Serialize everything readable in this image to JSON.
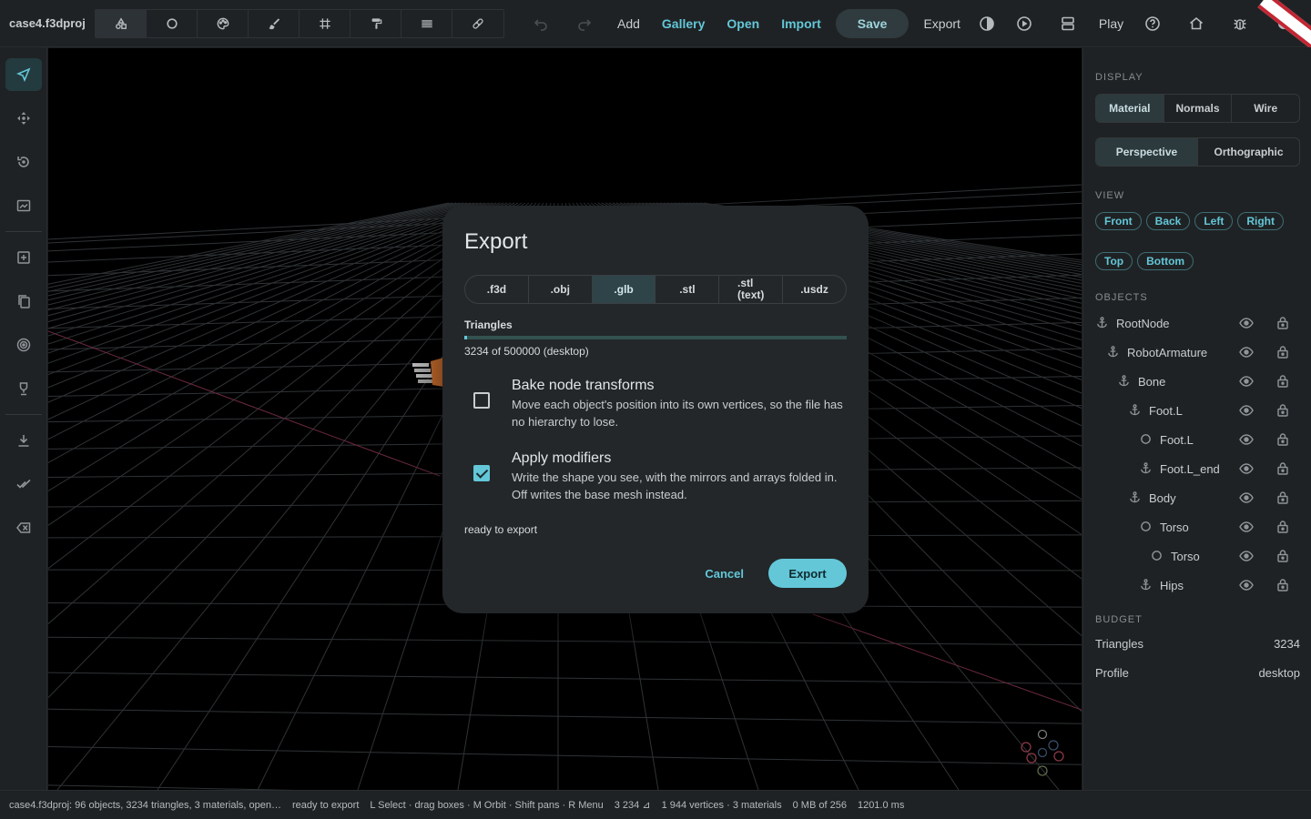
{
  "app": {
    "project_title": "case4.f3dproj"
  },
  "toolbar": {
    "tools": [
      {
        "name": "shapes",
        "icon": "shapes-icon"
      },
      {
        "name": "circle",
        "icon": "circle-icon"
      },
      {
        "name": "palette",
        "icon": "palette-icon"
      },
      {
        "name": "brush",
        "icon": "brush-icon"
      },
      {
        "name": "grid",
        "icon": "grid-icon"
      },
      {
        "name": "paint-roller",
        "icon": "paint-roller-icon"
      },
      {
        "name": "layers",
        "icon": "layers-icon"
      },
      {
        "name": "bandage",
        "icon": "bandage-icon"
      }
    ],
    "add": "Add",
    "gallery": "Gallery",
    "open": "Open",
    "import": "Import",
    "save": "Save",
    "export": "Export",
    "play": "Play"
  },
  "leftbar": {
    "items": [
      "select-arrow-icon",
      "move-icon",
      "rotate-icon",
      "frame-icon",
      "add-box-icon",
      "copy-icon",
      "target-icon",
      "trophy-icon",
      "download-icon",
      "done-all-icon",
      "backspace-icon"
    ]
  },
  "right_panel": {
    "display_heading": "DISPLAY",
    "display_modes": [
      "Material",
      "Normals",
      "Wire"
    ],
    "projection_modes": [
      "Perspective",
      "Orthographic"
    ],
    "view_heading": "VIEW",
    "view_row1": [
      "Front",
      "Back",
      "Left",
      "Right"
    ],
    "view_row2": [
      "Top",
      "Bottom"
    ],
    "objects_heading": "OBJECTS",
    "objects": [
      {
        "label": "RootNode",
        "type": "anchor",
        "depth": 0
      },
      {
        "label": "RobotArmature",
        "type": "anchor",
        "depth": 1
      },
      {
        "label": "Bone",
        "type": "anchor",
        "depth": 2
      },
      {
        "label": "Foot.L",
        "type": "anchor",
        "depth": 3
      },
      {
        "label": "Foot.L",
        "type": "mesh",
        "depth": 4
      },
      {
        "label": "Foot.L_end",
        "type": "anchor",
        "depth": 4
      },
      {
        "label": "Body",
        "type": "anchor",
        "depth": 3
      },
      {
        "label": "Torso",
        "type": "mesh",
        "depth": 4
      },
      {
        "label": "Torso",
        "type": "mesh",
        "depth": 5
      },
      {
        "label": "Hips",
        "type": "anchor",
        "depth": 4
      }
    ],
    "budget_heading": "BUDGET",
    "budget": [
      {
        "label": "Triangles",
        "value": "3234"
      },
      {
        "label": "Profile",
        "value": "desktop"
      }
    ]
  },
  "modal": {
    "title": "Export",
    "formats": [
      ".f3d",
      ".obj",
      ".glb",
      ".stl",
      ".stl\n(text)",
      ".usdz"
    ],
    "active_format": ".glb",
    "triangles_label": "Triangles",
    "triangles_fraction": 0.006468,
    "triangles_text": "3234 of 500000 (desktop)",
    "options": [
      {
        "title": "Bake node transforms",
        "desc": "Move each object's position into its own vertices, so the file has no hierarchy to lose.",
        "checked": false
      },
      {
        "title": "Apply modifiers",
        "desc": "Write the shape you see, with the mirrors and arrays folded in. Off writes the base mesh instead.",
        "checked": true
      }
    ],
    "status": "ready to export",
    "cancel": "Cancel",
    "export": "Export"
  },
  "statusbar": {
    "items": [
      "case4.f3dproj: 96 objects, 3234 triangles, 3 materials, open…",
      "ready to export",
      "L Select · drag boxes · M Orbit · Shift pans · R Menu",
      "3 234 ⊿",
      "1 944 vertices · 3 materials",
      "0 MB of 256",
      "1201.0 ms"
    ]
  },
  "colors": {
    "accent": "#63c7d8",
    "background": "#1b1d1f",
    "viewport": "#000000"
  }
}
